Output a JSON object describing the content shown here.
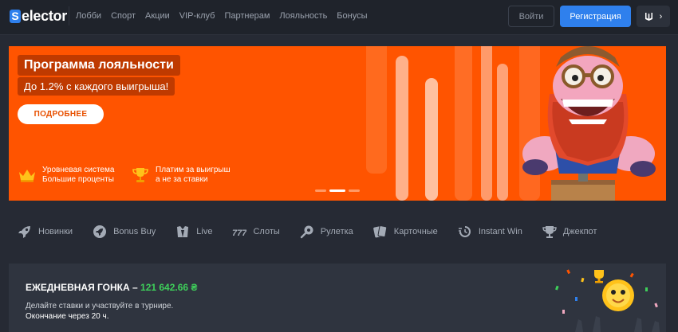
{
  "logo": {
    "badge": "S",
    "text": "elector"
  },
  "nav": [
    "Лобби",
    "Спорт",
    "Акции",
    "VIP-клуб",
    "Партнерам",
    "Лояльность",
    "Бонусы"
  ],
  "header": {
    "login": "Войти",
    "register": "Регистрация",
    "lang_arrow": "›"
  },
  "banner": {
    "title": "Программа лояльности",
    "subtitle": "До 1.2% с каждого выигрыша!",
    "button": "ПОДРОБНЕЕ",
    "features": [
      {
        "line1": "Уровневая система",
        "line2": "Большие проценты",
        "icon": "crown-icon"
      },
      {
        "line1": "Платим за выигрыш",
        "line2": "а не за ставки",
        "icon": "trophy-icon"
      }
    ],
    "slides": 3,
    "active_slide": 2,
    "colors": {
      "bg": "#ff5400",
      "accent": "#bf3a00"
    }
  },
  "categories": [
    {
      "label": "Новинки",
      "icon": "rocket-icon"
    },
    {
      "label": "Bonus Buy",
      "icon": "rocket-circle-icon"
    },
    {
      "label": "Live",
      "icon": "live-dealer-icon"
    },
    {
      "label": "Слоты",
      "icon": "slots-777-icon"
    },
    {
      "label": "Рулетка",
      "icon": "roulette-icon"
    },
    {
      "label": "Карточные",
      "icon": "cards-icon"
    },
    {
      "label": "Instant Win",
      "icon": "instant-win-icon"
    },
    {
      "label": "Джекпот",
      "icon": "jackpot-icon"
    }
  ],
  "race": {
    "title": "ЕЖЕДНЕВНАЯ ГОНКА –",
    "amount": "121 642.66 ₴",
    "description": "Делайте ставки и участвуйте в турнире.",
    "ends": "Окончание через 20 ч."
  }
}
